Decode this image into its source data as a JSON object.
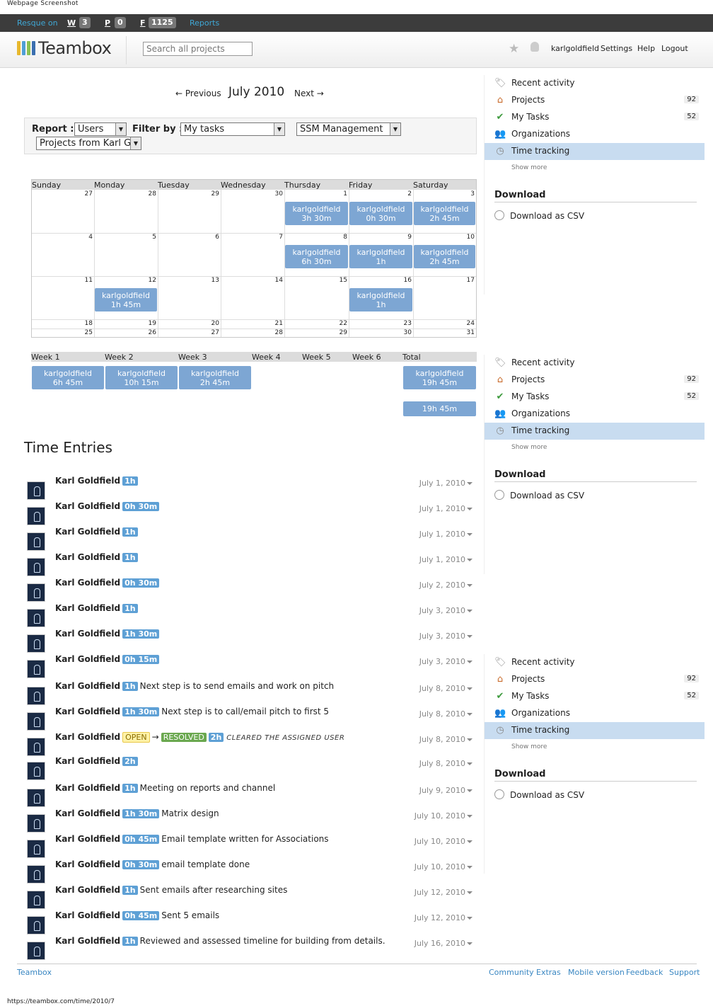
{
  "caption": "Webpage Screenshot",
  "status_url": "https://teambox.com/time/2010/7",
  "resque": {
    "label": "Resque on",
    "w_key": "W",
    "w_count": "3",
    "p_key": "P",
    "p_count": "0",
    "f_key": "F",
    "f_count": "1125",
    "reports": "Reports"
  },
  "header": {
    "logo": "Teambox",
    "search_placeholder": "Search all projects",
    "user": "karlgoldfield",
    "settings": "Settings",
    "help": "Help",
    "logout": "Logout"
  },
  "month": {
    "prev": "← Previous",
    "title": "July 2010",
    "next": "Next →"
  },
  "filters": {
    "report_label": "Report :",
    "report_value": "Users",
    "filter_label": "Filter by :",
    "filter_value": "My tasks",
    "project_value": "SSM Management",
    "scope_value": "Projects from Karl Go"
  },
  "calendar": {
    "days": [
      "Sunday",
      "Monday",
      "Tuesday",
      "Wednesday",
      "Thursday",
      "Friday",
      "Saturday"
    ],
    "weeks": [
      [
        "27",
        "28",
        "29",
        "30",
        "1",
        "2",
        "3"
      ],
      [
        "4",
        "5",
        "6",
        "7",
        "8",
        "9",
        "10"
      ],
      [
        "11",
        "12",
        "13",
        "14",
        "15",
        "16",
        "17"
      ],
      [
        "18",
        "19",
        "20",
        "21",
        "22",
        "23",
        "24"
      ],
      [
        "25",
        "26",
        "27",
        "28",
        "29",
        "30",
        "31"
      ]
    ],
    "chips": [
      {
        "week": 0,
        "day": 4,
        "user": "karlgoldfield",
        "time": "3h 30m"
      },
      {
        "week": 0,
        "day": 5,
        "user": "karlgoldfield",
        "time": "0h 30m"
      },
      {
        "week": 0,
        "day": 6,
        "user": "karlgoldfield",
        "time": "2h 45m"
      },
      {
        "week": 1,
        "day": 4,
        "user": "karlgoldfield",
        "time": "6h 30m"
      },
      {
        "week": 1,
        "day": 5,
        "user": "karlgoldfield",
        "time": "1h"
      },
      {
        "week": 1,
        "day": 6,
        "user": "karlgoldfield",
        "time": "2h 45m"
      },
      {
        "week": 2,
        "day": 1,
        "user": "karlgoldfield",
        "time": "1h 45m"
      },
      {
        "week": 2,
        "day": 5,
        "user": "karlgoldfield",
        "time": "1h"
      }
    ]
  },
  "weekly": {
    "headers": [
      "Week 1",
      "Week 2",
      "Week 3",
      "Week 4",
      "Week 5",
      "Week 6",
      "Total"
    ],
    "chips": [
      {
        "col": 0,
        "user": "karlgoldfield",
        "time": "6h 45m"
      },
      {
        "col": 1,
        "user": "karlgoldfield",
        "time": "10h 15m"
      },
      {
        "col": 2,
        "user": "karlgoldfield",
        "time": "2h 45m"
      },
      {
        "col": 6,
        "user": "karlgoldfield",
        "time": "19h 45m"
      }
    ],
    "grand_total": "19h 45m"
  },
  "entries_title": "Time Entries",
  "entries": [
    {
      "name": "Karl Goldfield",
      "time": "1h",
      "note": "",
      "date": "July 1, 2010"
    },
    {
      "name": "Karl Goldfield",
      "time": "0h 30m",
      "note": "",
      "date": "July 1, 2010"
    },
    {
      "name": "Karl Goldfield",
      "time": "1h",
      "note": "",
      "date": "July 1, 2010"
    },
    {
      "name": "Karl Goldfield",
      "time": "1h",
      "note": "",
      "date": "July 1, 2010"
    },
    {
      "name": "Karl Goldfield",
      "time": "0h 30m",
      "note": "",
      "date": "July 2, 2010"
    },
    {
      "name": "Karl Goldfield",
      "time": "1h",
      "note": "",
      "date": "July 3, 2010"
    },
    {
      "name": "Karl Goldfield",
      "time": "1h 30m",
      "note": "",
      "date": "July 3, 2010"
    },
    {
      "name": "Karl Goldfield",
      "time": "0h 15m",
      "note": "",
      "date": "July 3, 2010"
    },
    {
      "name": "Karl Goldfield",
      "time": "1h",
      "note": "Next step is to send emails and work on pitch",
      "date": "July 8, 2010"
    },
    {
      "name": "Karl Goldfield",
      "time": "1h 30m",
      "note": "Next step is to call/email pitch to first 5",
      "date": "July 8, 2010"
    },
    {
      "name": "Karl Goldfield",
      "status_from": "OPEN",
      "arrow": "→",
      "status_to": "RESOLVED",
      "time": "2h",
      "italic": "CLEARED THE ASSIGNED USER",
      "date": "July 8, 2010"
    },
    {
      "name": "Karl Goldfield",
      "time": "2h",
      "note": "",
      "date": "July 8, 2010"
    },
    {
      "name": "Karl Goldfield",
      "time": "1h",
      "note": "Meeting on reports and channel",
      "date": "July 9, 2010"
    },
    {
      "name": "Karl Goldfield",
      "time": "1h 30m",
      "note": "Matrix design",
      "date": "July 10, 2010"
    },
    {
      "name": "Karl Goldfield",
      "time": "0h 45m",
      "note": "Email template written for Associations",
      "date": "July 10, 2010"
    },
    {
      "name": "Karl Goldfield",
      "time": "0h 30m",
      "note": "email template done",
      "date": "July 10, 2010"
    },
    {
      "name": "Karl Goldfield",
      "time": "1h",
      "note": "Sent emails after researching sites",
      "date": "July 12, 2010"
    },
    {
      "name": "Karl Goldfield",
      "time": "0h 45m",
      "note": "Sent 5 emails",
      "date": "July 12, 2010"
    },
    {
      "name": "Karl Goldfield",
      "time": "1h",
      "note": "Reviewed and assessed timeline for building from details.",
      "date": "July 16, 2010"
    }
  ],
  "sidebar": {
    "items": [
      {
        "label": "Recent activity",
        "icon": "tag-icon",
        "count": ""
      },
      {
        "label": "Projects",
        "icon": "house-icon",
        "count": "92"
      },
      {
        "label": "My Tasks",
        "icon": "check-icon",
        "count": "52"
      },
      {
        "label": "Organizations",
        "icon": "people-icon",
        "count": ""
      },
      {
        "label": "Time tracking",
        "icon": "clock-icon",
        "count": "",
        "active": true
      }
    ],
    "show_more": "Show more",
    "download_title": "Download",
    "download_csv": "Download as CSV"
  },
  "footer": {
    "brand": "Teambox",
    "links": [
      "Community",
      "Extras",
      "Mobile version",
      "Feedback",
      "Support"
    ]
  }
}
